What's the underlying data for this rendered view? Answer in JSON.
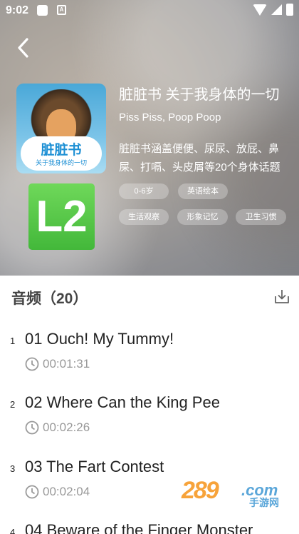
{
  "status_bar": {
    "time": "9:02",
    "notif_letter": "A"
  },
  "book": {
    "cover_title": "脏脏书",
    "cover_subtitle": "关于我身体的一切",
    "level": "L2",
    "title": "脏脏书 关于我身体的一切",
    "subtitle": "Piss Piss, Poop Poop",
    "description": "脏脏书涵盖便便、尿尿、放屁、鼻屎、打嗝、头皮屑等20个身体话题",
    "tags": [
      "0-6岁",
      "英语绘本",
      "生活观察",
      "形象记忆",
      "卫生习惯"
    ]
  },
  "audio": {
    "section_title": "音频（20）"
  },
  "tracks": [
    {
      "num": "1",
      "title": "01 Ouch! My Tummy!",
      "duration": "00:01:31"
    },
    {
      "num": "2",
      "title": "02 Where Can the King Pee",
      "duration": "00:02:26"
    },
    {
      "num": "3",
      "title": "03 The Fart Contest",
      "duration": "00:02:04"
    },
    {
      "num": "4",
      "title": "04 Beware of the Finger Monster",
      "duration": ""
    }
  ],
  "watermark": {
    "logo": "289",
    "domain": ".com",
    "site": "手游网"
  },
  "colors": {
    "level_badge": "#4cc043",
    "watermark_orange": "#f7a33a",
    "watermark_blue": "#5aa6d9"
  }
}
